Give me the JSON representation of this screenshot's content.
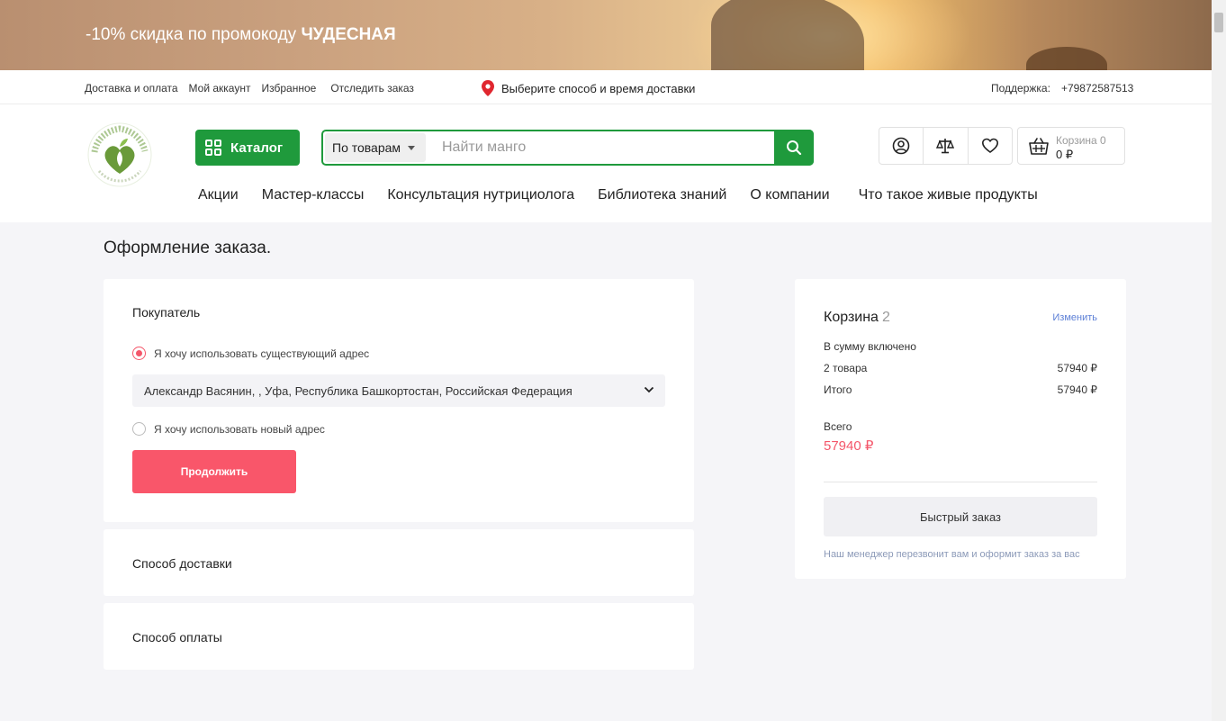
{
  "promo": {
    "text_prefix": "-10% скидка по промокоду",
    "code": "ЧУДЕСНАЯ"
  },
  "topbar": {
    "links": [
      "Доставка и оплата",
      "Мой аккаунт",
      "Избранное",
      "Отследить заказ"
    ],
    "delivery_text": "Выберите способ и время доставки",
    "support_label": "Поддержка:",
    "phone": "+79872587513"
  },
  "logo": {
    "text": "ЧУДЕСНАЯ ЖИЗНЬ",
    "tagline": "вкусно · здорово · полезно",
    "color": "#6a9a3a"
  },
  "catalog": {
    "label": "Каталог"
  },
  "search": {
    "scope": "По товарам",
    "placeholder": "Найти манго",
    "value": ""
  },
  "cart": {
    "label": "Корзина 0",
    "total": "0 ₽"
  },
  "nav": [
    "Акции",
    "Мастер-классы",
    "Консультация нутрициолога",
    "Библиотека знаний",
    "О компании",
    "Что такое живые продукты"
  ],
  "page": {
    "title": "Оформление заказа."
  },
  "buyer": {
    "title": "Покупатель",
    "option_existing": "Я хочу использовать существующий адрес",
    "option_new": "Я хочу использовать новый адрес",
    "selected_option": "existing",
    "address": "Александр Васянин, , Уфа, Республика Башкортостан, Российская Федерация",
    "continue_label": "Продолжить"
  },
  "delivery_method": {
    "title": "Способ доставки"
  },
  "payment_method": {
    "title": "Способ оплаты"
  },
  "summary": {
    "title": "Корзина",
    "count": "2",
    "change_label": "Изменить",
    "included_label": "В сумму включено",
    "items_label": "2 товара",
    "items_value": "57940 ₽",
    "subtotal_label": "Итого",
    "subtotal_value": "57940 ₽",
    "total_label": "Всего",
    "total_value": "57940 ₽",
    "quick_order_label": "Быстрый заказ",
    "note": "Наш менеджер перезвонит вам и оформит заказ за вас"
  },
  "colors": {
    "brand_green": "#1f9a3c",
    "accent_red": "#f9566a",
    "link_blue": "#5c7fd6"
  },
  "icons": [
    "location-pin-icon",
    "grid-icon",
    "search-icon",
    "user-icon",
    "compare-scales-icon",
    "heart-icon",
    "basket-icon",
    "chevron-down-icon"
  ]
}
